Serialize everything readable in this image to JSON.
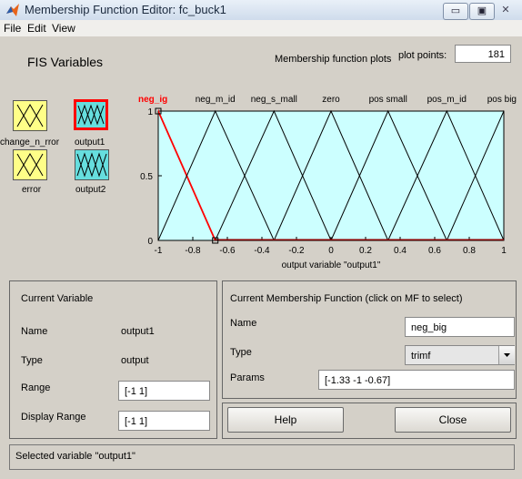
{
  "window": {
    "title": "Membership Function Editor: fc_buck1",
    "controls": [
      "▭",
      "▣",
      "✕"
    ]
  },
  "menu": {
    "file": "File",
    "edit": "Edit",
    "view": "View"
  },
  "fis": {
    "title": "FIS Variables",
    "vars": [
      {
        "label": "change_n_rror",
        "type": "input"
      },
      {
        "label": "output1",
        "type": "output"
      },
      {
        "label": "error",
        "type": "input"
      },
      {
        "label": "output2",
        "type": "output"
      }
    ]
  },
  "plot": {
    "title": "Membership function plots",
    "points_label": "plot points:",
    "points_value": "181",
    "xlabel": "output variable \"output1\"",
    "xticks": [
      "-1",
      "-0.8",
      "-0.6",
      "-0.4",
      "-0.2",
      "0",
      "0.2",
      "0.4",
      "0.6",
      "0.8",
      "1"
    ],
    "yticks": [
      "0",
      "0.5",
      "1"
    ],
    "mf_labels": [
      "neg_ig",
      "neg_m_id",
      "neg_s_mall",
      "zero",
      "pos small",
      "pos_m_id",
      "pos big"
    ],
    "colors": {
      "bg": "#ccffff",
      "selected": "#ff0000",
      "line": "#000000",
      "baseline": "#8b0000"
    }
  },
  "chart_data": {
    "type": "line",
    "xlim": [
      -1,
      1
    ],
    "ylim": [
      0,
      1
    ],
    "series": [
      {
        "name": "neg_big",
        "points": [
          [
            -1.33,
            0
          ],
          [
            -1,
            1
          ],
          [
            -0.67,
            0
          ]
        ],
        "selected": true
      },
      {
        "name": "neg_mid",
        "points": [
          [
            -1,
            0
          ],
          [
            -0.67,
            1
          ],
          [
            -0.33,
            0
          ]
        ]
      },
      {
        "name": "neg_small",
        "points": [
          [
            -0.67,
            0
          ],
          [
            -0.33,
            1
          ],
          [
            0,
            0
          ]
        ]
      },
      {
        "name": "zero",
        "points": [
          [
            -0.33,
            0
          ],
          [
            0,
            1
          ],
          [
            0.33,
            0
          ]
        ]
      },
      {
        "name": "pos_small",
        "points": [
          [
            0,
            0
          ],
          [
            0.33,
            1
          ],
          [
            0.67,
            0
          ]
        ]
      },
      {
        "name": "pos_mid",
        "points": [
          [
            0.33,
            0
          ],
          [
            0.67,
            1
          ],
          [
            1,
            0
          ]
        ]
      },
      {
        "name": "pos_big",
        "points": [
          [
            0.67,
            0
          ],
          [
            1,
            1
          ],
          [
            1.33,
            0
          ]
        ]
      }
    ]
  },
  "current_variable": {
    "title": "Current Variable",
    "name_label": "Name",
    "name_value": "output1",
    "type_label": "Type",
    "type_value": "output",
    "range_label": "Range",
    "range_value": "[-1 1]",
    "display_range_label": "Display Range",
    "display_range_value": "[-1 1]"
  },
  "current_mf": {
    "title": "Current Membership Function (click on MF to select)",
    "name_label": "Name",
    "name_value": "neg_big",
    "type_label": "Type",
    "type_value": "trimf",
    "params_label": "Params",
    "params_value": "[-1.33 -1 -0.67]"
  },
  "buttons": {
    "help": "Help",
    "close": "Close"
  },
  "status": "Selected variable \"output1\""
}
